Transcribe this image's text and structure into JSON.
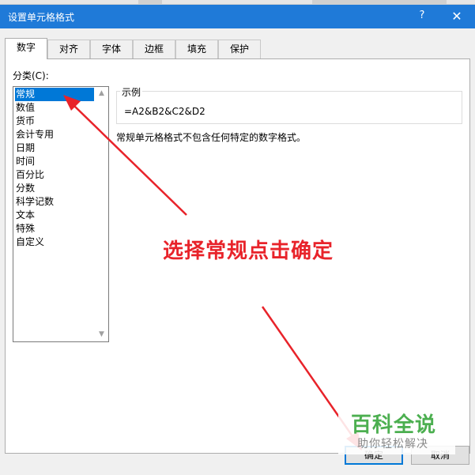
{
  "window": {
    "title": "设置单元格格式",
    "help_glyph": "?",
    "close_glyph": "✕"
  },
  "tabs": [
    {
      "label": "数字",
      "active": true
    },
    {
      "label": "对齐",
      "active": false
    },
    {
      "label": "字体",
      "active": false
    },
    {
      "label": "边框",
      "active": false
    },
    {
      "label": "填充",
      "active": false
    },
    {
      "label": "保护",
      "active": false
    }
  ],
  "number_tab": {
    "category_label": "分类(C):",
    "categories": [
      "常规",
      "数值",
      "货币",
      "会计专用",
      "日期",
      "时间",
      "百分比",
      "分数",
      "科学记数",
      "文本",
      "特殊",
      "自定义"
    ],
    "selected_index": 0,
    "sample_legend": "示例",
    "sample_value": "=A2&B2&C2&D2",
    "description": "常规单元格格式不包含任何特定的数字格式。"
  },
  "buttons": {
    "ok": "确定",
    "cancel": "取消"
  },
  "annotation": {
    "text": "选择常规点击确定",
    "color": "#e8232a"
  },
  "watermark": {
    "main": "百科全说",
    "sub": "助你轻松解决"
  },
  "colors": {
    "titlebar": "#1f7ad8",
    "selection": "#0078d7",
    "arrow": "#e8232a",
    "watermark_green": "#4caf50"
  }
}
